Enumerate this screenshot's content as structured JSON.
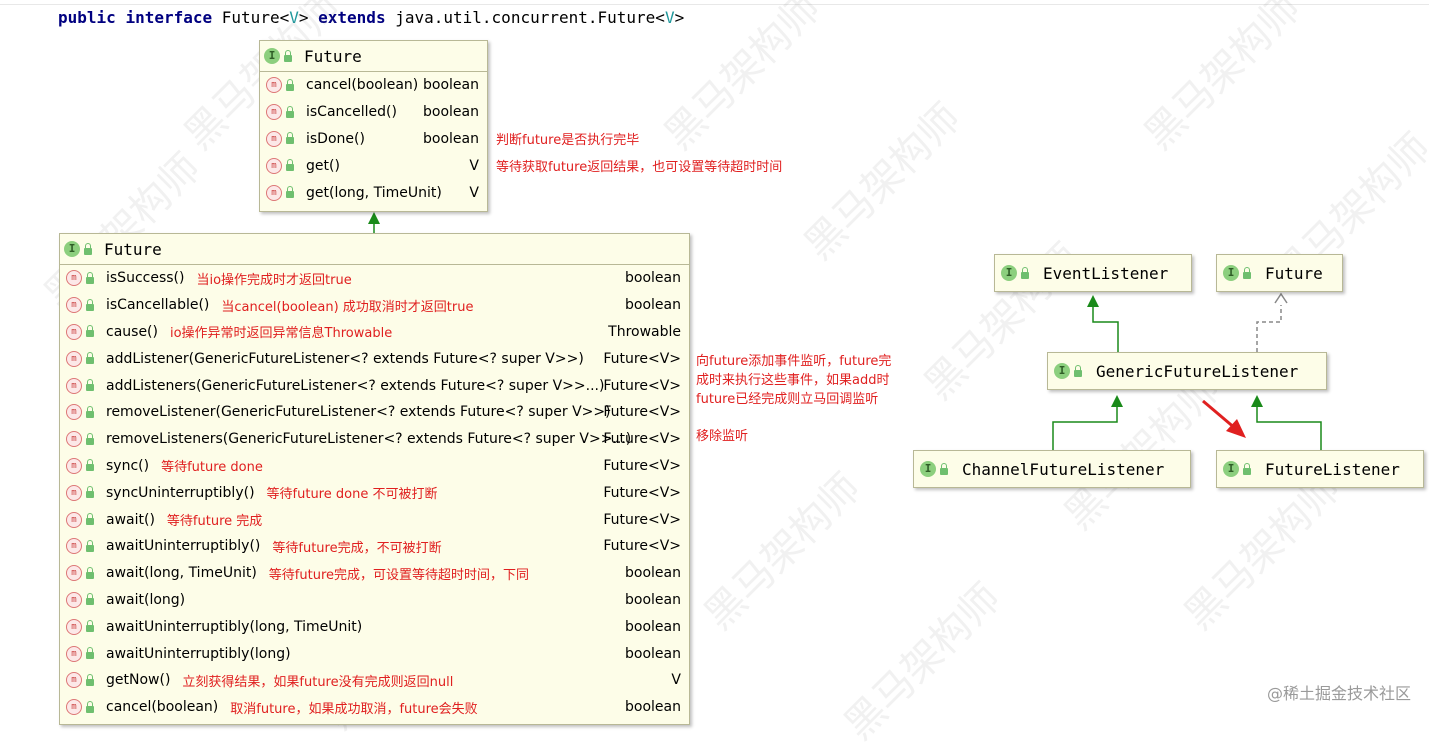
{
  "declaration": {
    "kw1": "public",
    "kw2": "interface",
    "name": "Future<",
    "tparam": "V",
    "close": ">",
    "kw3": "extends",
    "parent": "java.util.concurrent.Future<",
    "parent_tparam": "V",
    "parent_close": ">"
  },
  "jdk_future": {
    "title": "Future",
    "methods": [
      {
        "name": "cancel(boolean)",
        "type": "boolean",
        "note": ""
      },
      {
        "name": "isCancelled()",
        "type": "boolean",
        "note": ""
      },
      {
        "name": "isDone()",
        "type": "boolean",
        "note": "判断future是否执行完毕"
      },
      {
        "name": "get()",
        "type": "V",
        "note": "等待获取future返回结果，也可设置等待超时时间"
      },
      {
        "name": "get(long, TimeUnit)",
        "type": "V",
        "note": ""
      }
    ]
  },
  "netty_future": {
    "title": "Future",
    "methods": [
      {
        "name": "isSuccess()",
        "type": "boolean",
        "note": "当io操作完成时才返回true"
      },
      {
        "name": "isCancellable()",
        "type": "boolean",
        "note": "当cancel(boolean) 成功取消时才返回true"
      },
      {
        "name": "cause()",
        "type": "Throwable",
        "note": "io操作异常时返回异常信息Throwable"
      },
      {
        "name": "addListener(GenericFutureListener<? extends Future<? super V>>)",
        "type": "Future<V>",
        "note": ""
      },
      {
        "name": "addListeners(GenericFutureListener<? extends Future<? super V>>...)",
        "type": "Future<V>",
        "note": ""
      },
      {
        "name": "removeListener(GenericFutureListener<? extends Future<? super V>>)",
        "type": "Future<V>",
        "note": ""
      },
      {
        "name": "removeListeners(GenericFutureListener<? extends Future<? super V>>...)",
        "type": "Future<V>",
        "note": ""
      },
      {
        "name": "sync()",
        "type": "Future<V>",
        "note": "等待future done"
      },
      {
        "name": "syncUninterruptibly()",
        "type": "Future<V>",
        "note": "等待future done 不可被打断"
      },
      {
        "name": "await()",
        "type": "Future<V>",
        "note": "等待future 完成"
      },
      {
        "name": "awaitUninterruptibly()",
        "type": "Future<V>",
        "note": "等待future完成，不可被打断"
      },
      {
        "name": "await(long, TimeUnit)",
        "type": "boolean",
        "note": "等待future完成，可设置等待超时时间，下同"
      },
      {
        "name": "await(long)",
        "type": "boolean",
        "note": ""
      },
      {
        "name": "awaitUninterruptibly(long, TimeUnit)",
        "type": "boolean",
        "note": ""
      },
      {
        "name": "awaitUninterruptibly(long)",
        "type": "boolean",
        "note": ""
      },
      {
        "name": "getNow()",
        "type": "V",
        "note": "立刻获得结果，如果future没有完成则返回null"
      },
      {
        "name": "cancel(boolean)",
        "type": "boolean",
        "note": "取消future，如果成功取消，future会失败"
      }
    ]
  },
  "listener_note": {
    "line1": "向future添加事件监听，future完",
    "line2": "成时来执行这些事件，如果add时",
    "line3": "future已经完成则立马回调监听"
  },
  "remove_note": "移除监听",
  "hierarchy": {
    "event_listener": "EventListener",
    "future": "Future",
    "generic_listener": "GenericFutureListener",
    "channel_listener": "ChannelFutureListener",
    "future_listener": "FutureListener"
  },
  "badges": {
    "interface": "I",
    "method": "m"
  },
  "watermark": "黑马架构师",
  "footer": "@稀土掘金技术社区",
  "colors": {
    "note": "#e02020",
    "box_bg": "#fdfde8",
    "extends_arrow": "#1a8a1a",
    "implements_arrow": "#888888"
  }
}
